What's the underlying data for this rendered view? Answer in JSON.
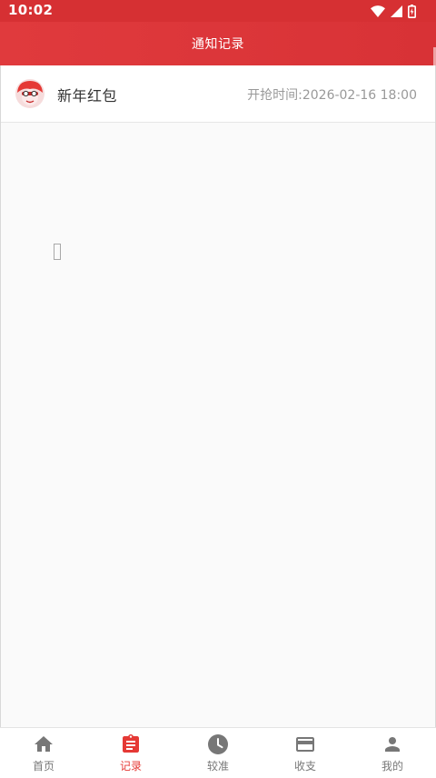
{
  "status_bar": {
    "time": "10:02",
    "icons": [
      "wifi-icon",
      "signal-icon",
      "battery-charging-icon"
    ]
  },
  "app_bar": {
    "title": "通知记录"
  },
  "records": [
    {
      "avatar_icon": "red-packet-avatar-icon",
      "title": "新年红包",
      "time": "开抢时间:2026-02-16 18:00"
    }
  ],
  "placeholder_glyph": "missing-glyph-box",
  "tab_bar": {
    "active_index": 1,
    "tabs": [
      {
        "label": "首页",
        "icon": "home-icon"
      },
      {
        "label": "记录",
        "icon": "clipboard-icon"
      },
      {
        "label": "较准",
        "icon": "clock-icon"
      },
      {
        "label": "收支",
        "icon": "credit-card-icon"
      },
      {
        "label": "我的",
        "icon": "person-icon"
      }
    ]
  },
  "colors": {
    "primary": "#d63033",
    "active_tab": "#e53935",
    "inactive_tab": "#777777",
    "background": "#fafafa"
  }
}
